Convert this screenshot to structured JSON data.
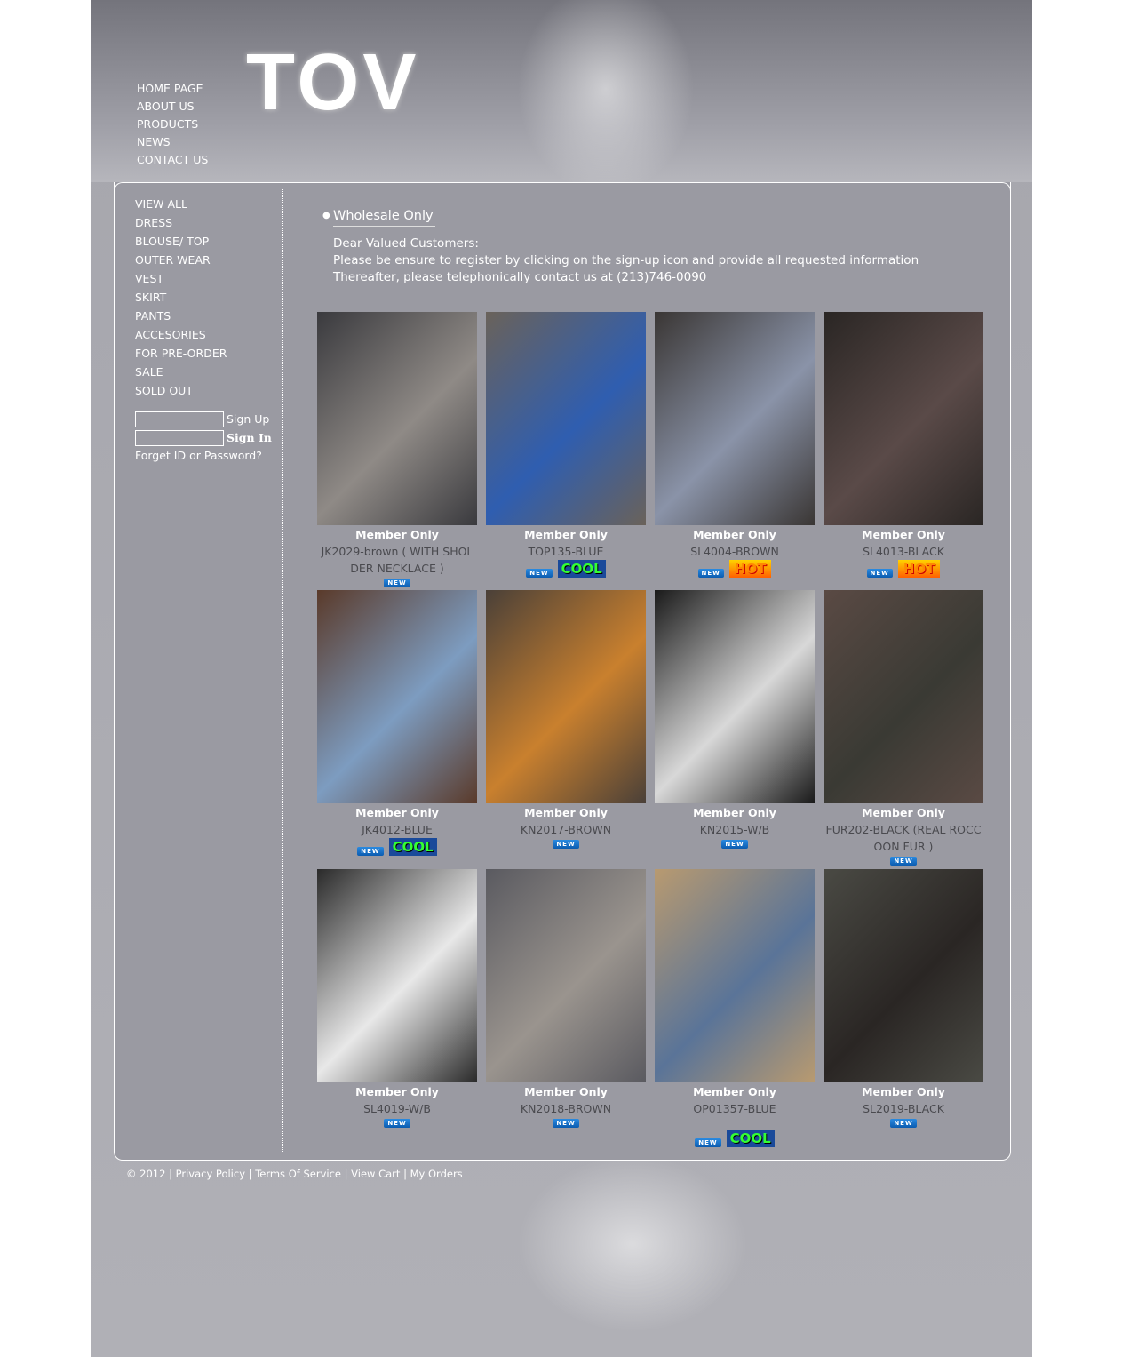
{
  "header": {
    "logo": "TOV",
    "nav": [
      "HOME PAGE",
      "ABOUT US",
      "PRODUCTS",
      "NEWS",
      "CONTACT US"
    ]
  },
  "sidebar": {
    "categories": [
      "VIEW ALL",
      "DRESS",
      "BLOUSE/ TOP",
      "OUTER WEAR",
      "VEST",
      "SKIRT",
      "PANTS",
      "ACCESORIES",
      "FOR PRE-ORDER",
      "SALE",
      "SOLD OUT"
    ],
    "login": {
      "id_value": "",
      "password_value": "",
      "sign_up": "Sign Up",
      "sign_in": "Sign In",
      "forgot": "Forget ID or Password?"
    }
  },
  "notice": {
    "title": "Wholesale Only",
    "lines": [
      "Dear Valued Customers:",
      "Please be ensure to register by clicking on the sign-up icon and provide all requested information",
      "Thereafter, please telephonically contact us at (213)746-0090"
    ]
  },
  "badge_labels": {
    "new": "NEW",
    "cool": "COOL",
    "hot": "HOT"
  },
  "products": [
    {
      "label": "Member Only",
      "code": "JK2029-brown ( WITH SHOL DER NECKLACE )",
      "badges": [
        "new"
      ],
      "colors": [
        "#3a3a3e",
        "#8f8a86"
      ]
    },
    {
      "label": "Member Only",
      "code": "TOP135-BLUE",
      "badges": [
        "new",
        "cool"
      ],
      "colors": [
        "#6a625a",
        "#2f5eb0"
      ]
    },
    {
      "label": "Member Only",
      "code": "SL4004-BROWN",
      "badges": [
        "new",
        "hot"
      ],
      "colors": [
        "#3a3634",
        "#8a93a8"
      ]
    },
    {
      "label": "Member Only",
      "code": "SL4013-BLACK",
      "badges": [
        "new",
        "hot"
      ],
      "colors": [
        "#2a2624",
        "#5a4a48"
      ]
    },
    {
      "label": "Member Only",
      "code": "JK4012-BLUE",
      "badges": [
        "new",
        "cool"
      ],
      "colors": [
        "#5a3a2a",
        "#7d9cc0"
      ]
    },
    {
      "label": "Member Only",
      "code": "KN2017-BROWN",
      "badges": [
        "new"
      ],
      "colors": [
        "#4a4038",
        "#c9802e"
      ]
    },
    {
      "label": "Member Only",
      "code": "KN2015-W/B",
      "badges": [
        "new"
      ],
      "colors": [
        "#1a1a1a",
        "#d8d8d8"
      ]
    },
    {
      "label": "Member Only",
      "code": "FUR202-BLACK (REAL ROCC OON FUR )",
      "badges": [
        "new"
      ],
      "colors": [
        "#5a4a44",
        "#3a3a34"
      ]
    },
    {
      "label": "Member Only",
      "code": "SL4019-W/B",
      "badges": [
        "new"
      ],
      "colors": [
        "#2a2a2a",
        "#e8e8e8"
      ]
    },
    {
      "label": "Member Only",
      "code": "KN2018-BROWN",
      "badges": [
        "new"
      ],
      "colors": [
        "#5a5a60",
        "#9a948e"
      ]
    },
    {
      "label": "Member Only",
      "code": "OP01357-BLUE",
      "badges": [
        "new",
        "cool"
      ],
      "colors": [
        "#b89a70",
        "#5a7498"
      ]
    },
    {
      "label": "Member Only",
      "code": "SL2019-BLACK",
      "badges": [
        "new"
      ],
      "colors": [
        "#4a4a44",
        "#2a2624"
      ]
    }
  ],
  "footer": [
    "© 2012",
    "Privacy Policy",
    "Terms Of Service",
    "View Cart",
    "My Orders"
  ]
}
